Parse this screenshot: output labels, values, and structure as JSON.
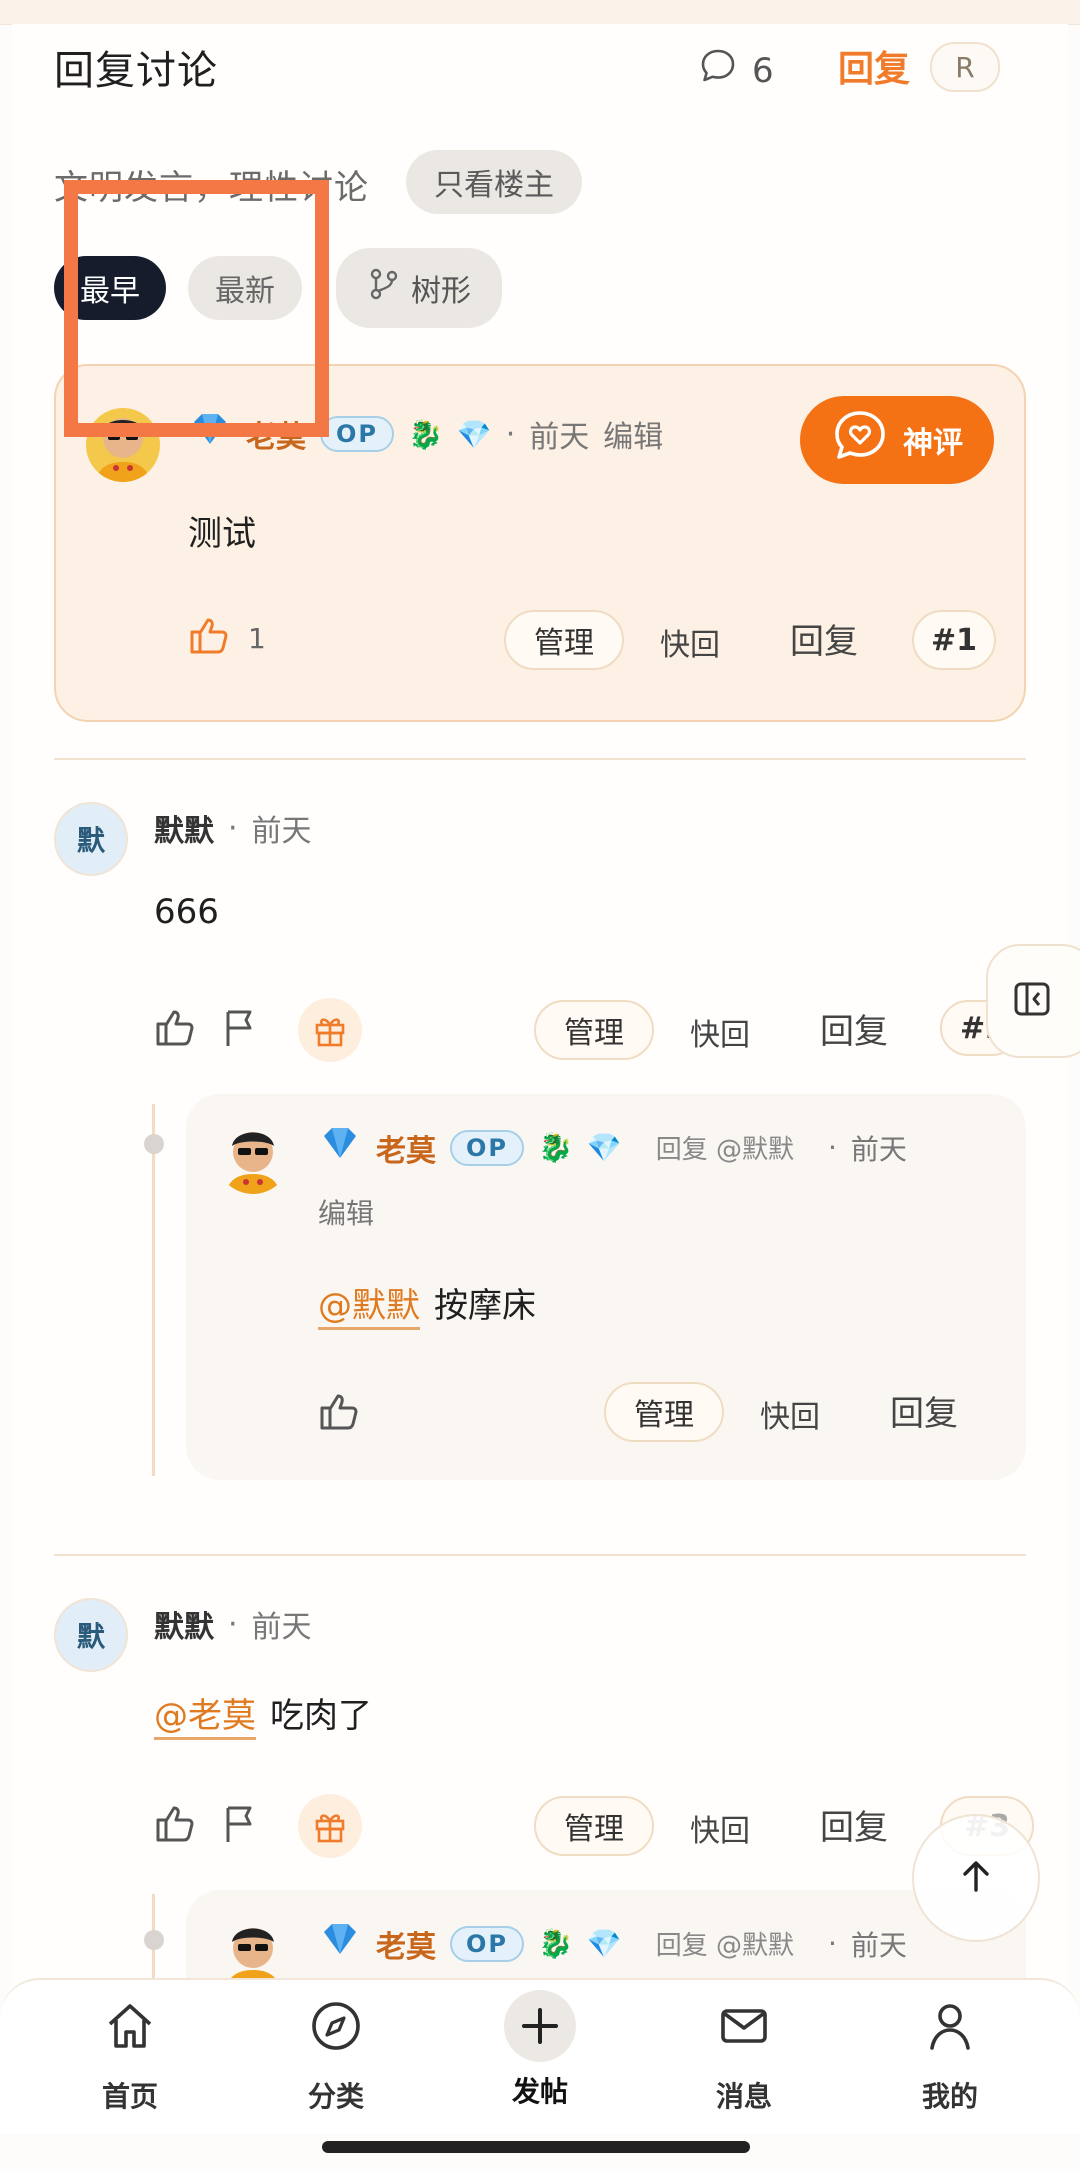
{
  "header": {
    "title": "回复讨论",
    "comment_count": "6",
    "reply_link": "回复",
    "shortcut": "R"
  },
  "filters": {
    "note": "文明发言，理性讨论",
    "only_op": "只看楼主",
    "sort_earliest": "最早",
    "sort_latest": "最新",
    "sort_tree": "树形"
  },
  "op_post": {
    "author": "老莫",
    "op_badge": "OP",
    "time": "前天",
    "edit": "编辑",
    "god_comment": "神评",
    "content": "测试",
    "likes": "1",
    "manage": "管理",
    "quick_reply": "快回",
    "reply": "回复",
    "floor": "#1"
  },
  "post2": {
    "avatar_text": "默",
    "author": "默默",
    "time": "前天",
    "content": "666",
    "manage": "管理",
    "quick_reply": "快回",
    "reply": "回复",
    "floor": "#2",
    "nested": {
      "author": "老莫",
      "op_badge": "OP",
      "reply_to": "回复 @默默",
      "time": "前天",
      "edit": "编辑",
      "mention": "@默默",
      "content": "按摩床",
      "manage": "管理",
      "quick_reply": "快回",
      "reply": "回复"
    }
  },
  "post3": {
    "avatar_text": "默",
    "author": "默默",
    "time": "前天",
    "mention": "@老莫",
    "content": "吃肉了",
    "manage": "管理",
    "quick_reply": "快回",
    "reply": "回复",
    "floor": "#3",
    "nested": {
      "author": "老莫",
      "op_badge": "OP",
      "reply_to": "回复 @默默",
      "time": "前天"
    }
  },
  "bottom_nav": {
    "home": "首页",
    "category": "分类",
    "post": "发帖",
    "messages": "消息",
    "me": "我的"
  },
  "colors": {
    "accent": "#f07b2a",
    "dark": "#161c2c",
    "op_card_bg": "#fdf1e5",
    "highlight": "#f47846"
  }
}
